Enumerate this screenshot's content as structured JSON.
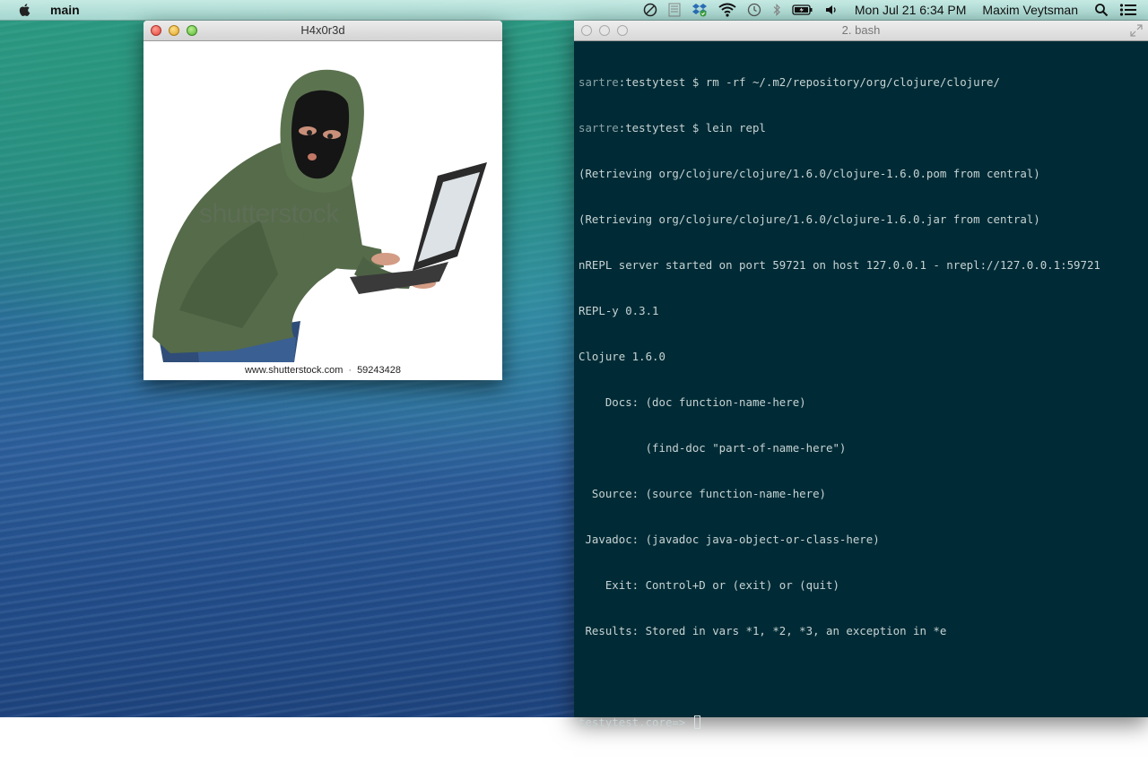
{
  "menubar": {
    "app_name": "main",
    "clock": "Mon Jul 21  6:34 PM",
    "user": "Maxim Veytsman"
  },
  "image_window": {
    "title": "H4x0r3d",
    "watermark": "shutterstock",
    "caption_site": "www.shutterstock.com",
    "caption_id": "59243428"
  },
  "terminal": {
    "title": "2. bash",
    "lines": [
      {
        "prefix": "sartre",
        "text": ":testytest $ rm -rf ~/.m2/repository/org/clojure/clojure/"
      },
      {
        "prefix": "sartre",
        "text": ":testytest $ lein repl"
      },
      {
        "prefix": "",
        "text": "(Retrieving org/clojure/clojure/1.6.0/clojure-1.6.0.pom from central)"
      },
      {
        "prefix": "",
        "text": "(Retrieving org/clojure/clojure/1.6.0/clojure-1.6.0.jar from central)"
      },
      {
        "prefix": "",
        "text": "nREPL server started on port 59721 on host 127.0.0.1 - nrepl://127.0.0.1:59721"
      },
      {
        "prefix": "",
        "text": "REPL-y 0.3.1"
      },
      {
        "prefix": "",
        "text": "Clojure 1.6.0"
      },
      {
        "prefix": "",
        "text": "    Docs: (doc function-name-here)"
      },
      {
        "prefix": "",
        "text": "          (find-doc \"part-of-name-here\")"
      },
      {
        "prefix": "",
        "text": "  Source: (source function-name-here)"
      },
      {
        "prefix": "",
        "text": " Javadoc: (javadoc java-object-or-class-here)"
      },
      {
        "prefix": "",
        "text": "    Exit: Control+D or (exit) or (quit)"
      },
      {
        "prefix": "",
        "text": " Results: Stored in vars *1, *2, *3, an exception in *e"
      },
      {
        "prefix": "",
        "text": ""
      }
    ],
    "prompt": "testytest.core=> "
  },
  "icons": [
    "apple-icon",
    "do-not-disturb-icon",
    "scroll-icon",
    "dropbox-icon",
    "wifi-icon",
    "time-machine-icon",
    "bluetooth-icon",
    "battery-icon",
    "volume-icon",
    "spotlight-icon",
    "notification-center-icon"
  ]
}
